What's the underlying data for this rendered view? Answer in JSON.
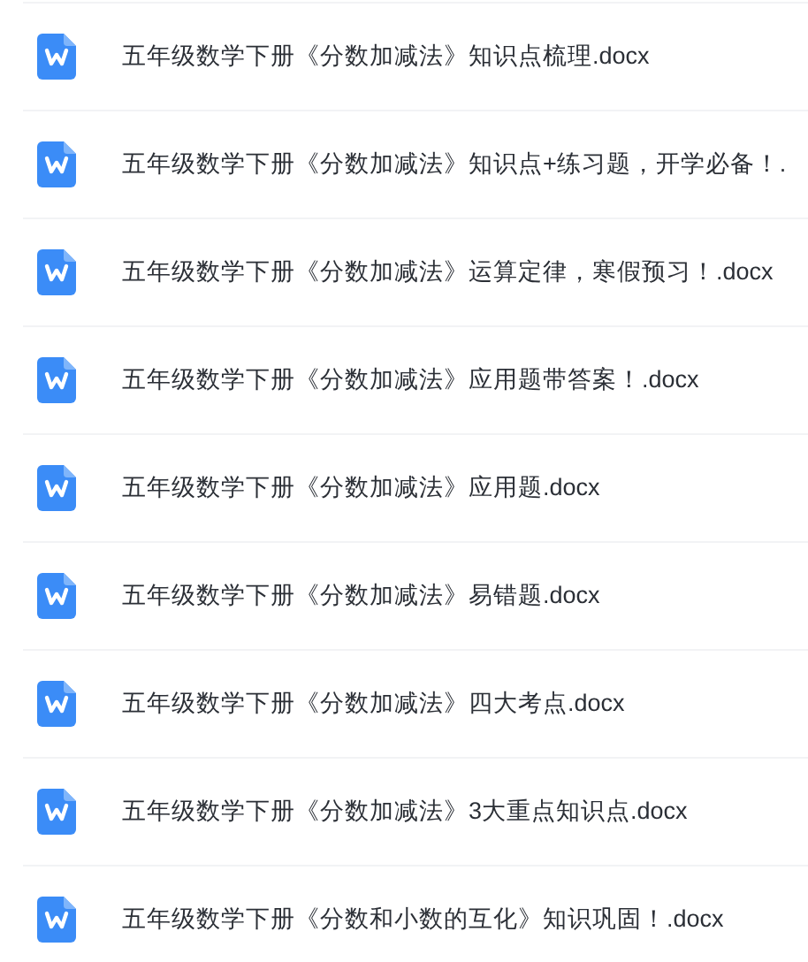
{
  "files": [
    {
      "name": "五年级数学下册《分数加减法》知识点梳理.docx"
    },
    {
      "name": "五年级数学下册《分数加减法》知识点+练习题，开学必备！."
    },
    {
      "name": "五年级数学下册《分数加减法》运算定律，寒假预习！.docx"
    },
    {
      "name": "五年级数学下册《分数加减法》应用题带答案！.docx"
    },
    {
      "name": "五年级数学下册《分数加减法》应用题.docx"
    },
    {
      "name": "五年级数学下册《分数加减法》易错题.docx"
    },
    {
      "name": "五年级数学下册《分数加减法》四大考点.docx"
    },
    {
      "name": "五年级数学下册《分数加减法》3大重点知识点.docx"
    },
    {
      "name": "五年级数学下册《分数和小数的互化》知识巩固！.docx"
    }
  ]
}
